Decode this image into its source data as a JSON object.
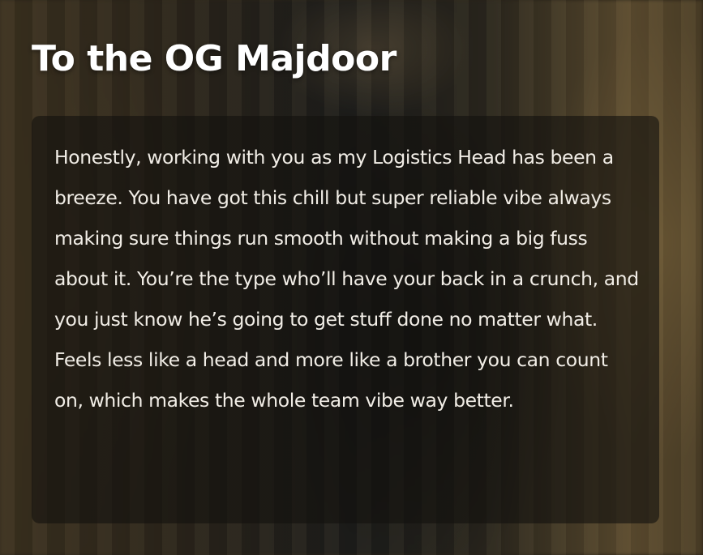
{
  "page": {
    "title": "To the OG Majdoor",
    "message": "Honestly, working with you as my Logistics Head has been a breeze. You have got this chill but super reliable vibe always making sure things run smooth without making a big fuss about it. You’re the type who’ll have your back in a crunch, and you just know he’s going to get stuff done no matter what. Feels less like a head and more like a brother you can count on, which makes the whole team vibe way better."
  },
  "colors": {
    "title_text": "#ffffff",
    "card_background": "rgba(20,18,14,0.62)",
    "body_text": "#f1ede6"
  }
}
